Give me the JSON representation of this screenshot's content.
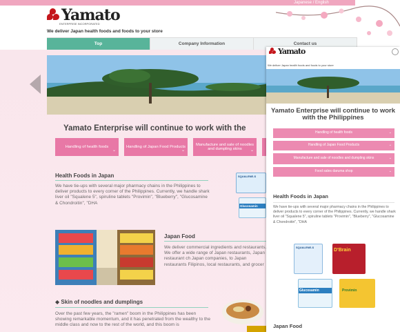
{
  "header": {
    "language_switch": "Japanese / English",
    "logo_text": "Yamato",
    "logo_sub": "ENTERPRISE INCORPORATED",
    "tagline": "We deliver Japan health foods and foods to your store"
  },
  "nav": {
    "items": [
      "Top",
      "Company Information",
      "Contact us"
    ]
  },
  "main": {
    "title": "Yamato Enterprise will continue to work with the",
    "buttons": [
      "Handling of health foods",
      "Handling of Japan Food Products",
      "Manufacture and sale of noodles and dumpling skins",
      ""
    ],
    "health": {
      "heading": "Health Foods in Japan",
      "text": "We have tie-ups with several major pharmacy chains in the Philippines to deliver products to every corner of the Philippines. Currently, we handle shark liver oil \"Squalene 5\", spiruline tablets \"Provimin\", \"Blueberry\", \"Glucosamine & Chondroitin\", \"DHA"
    },
    "japan_food": {
      "heading": "Japan Food",
      "text": "We deliver commercial ingredients and restaurants. We offer a wide range of Japan restaurants, Japan restaurant ch Japan companies, to Japan restaurants Filipinos, local restaurants, and grocer"
    },
    "noodles": {
      "heading": "Skin of noodles and dumplings",
      "text": "Over the past few years, the \"ramen\" boom in the Philippines has been showing remarkable momentum, and it has penetrated from the wealthy to the middle class and now to the rest of the world, and this boom is"
    }
  },
  "mobile": {
    "tagline": "We deliver Japan health foods and foods to your store",
    "title": "Yamato Enterprise will continue to work with the Philippines",
    "buttons": [
      "Handling of health foods",
      "Handling of Japan Food Products",
      "Manufacture and sale of noodles and dumpling skins",
      "Food sales daruma shop"
    ],
    "health_heading": "Health Foods in Japan",
    "health_text": "We have tie-ups with several major pharmacy chains in the Philippines to deliver products to every corner of the Philippines. Currently, we handle shark liver oil \"Squalene 5\", spiruline tablets \"Provimin\", \"Blueberry\", \"Glucosamine & Chondroitin\", \"DHA",
    "product_labels": [
      "SQUALENE-S",
      "D'Brain",
      "Glucosamin",
      "Provimin"
    ],
    "japan_food_heading": "Japan Food"
  },
  "products": [
    "SQUALENE-S",
    "Glucosamin"
  ],
  "colors": {
    "accent_pink": "#e878a6",
    "nav_active": "#58b49a",
    "section_line": "#8fd1bd"
  }
}
